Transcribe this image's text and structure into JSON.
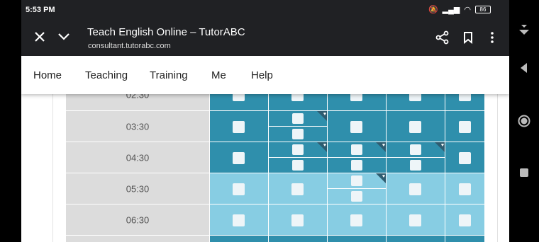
{
  "status_bar": {
    "time": "5:53 PM",
    "battery": "86"
  },
  "browser": {
    "title": "Teach English Online – TutorABC",
    "url": "consultant.tutorabc.com"
  },
  "nav": {
    "items": [
      "Home",
      "Teaching",
      "Training",
      "Me",
      "Help"
    ]
  },
  "schedule": {
    "partial_time": "02:30",
    "rows": [
      {
        "time": "03:30"
      },
      {
        "time": "04:30"
      },
      {
        "time": "05:30"
      },
      {
        "time": "06:30"
      }
    ]
  },
  "colors": {
    "booked": "#2f8fac",
    "open": "#87cde3",
    "time_column": "#dcdcdc",
    "favorite_corner": "#2d5c70"
  }
}
